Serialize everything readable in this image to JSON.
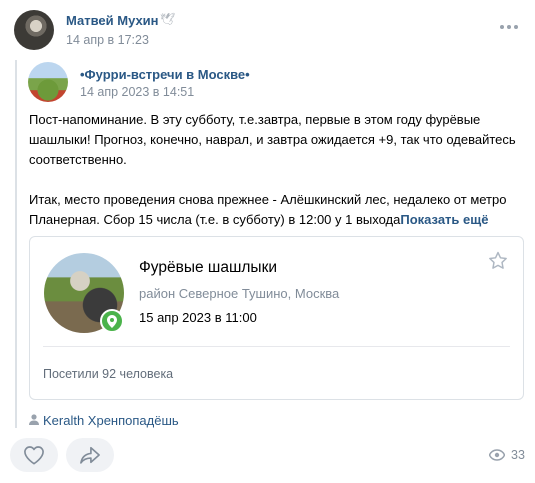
{
  "post": {
    "author": {
      "name": "Матвей Мухин",
      "time": "14 апр в 17:23"
    },
    "repost": {
      "group_name": "•Фурри-встречи в Москве•",
      "time": "14 апр 2023 в 14:51",
      "text_p1": "Пост-напоминание. В эту субботу, т.е.завтра, первые в этом году фурёвые шашлыки! Прогноз, конечно, наврал, и завтра ожидается +9, так что одевайтесь соответственно.",
      "text_p2": "Итак, место проведения снова прежнее - Алёшкинский лес, недалеко от метро Планерная. Сбор 15 числа (т.е. в субботу) в 12:00 у 1 выхода",
      "show_more": "Показать ещё"
    },
    "event": {
      "title": "Фурёвые шашлыки",
      "place": "район Северное Тушино, Москва",
      "date": "15 апр 2023 в 11:00",
      "visited": "Посетили 92 человека"
    },
    "signer": "Keralth Хренпопадёшь",
    "views": "33"
  },
  "colors": {
    "link": "#2a5885",
    "secondary": "#818c99",
    "pin": "#4bb34b"
  }
}
